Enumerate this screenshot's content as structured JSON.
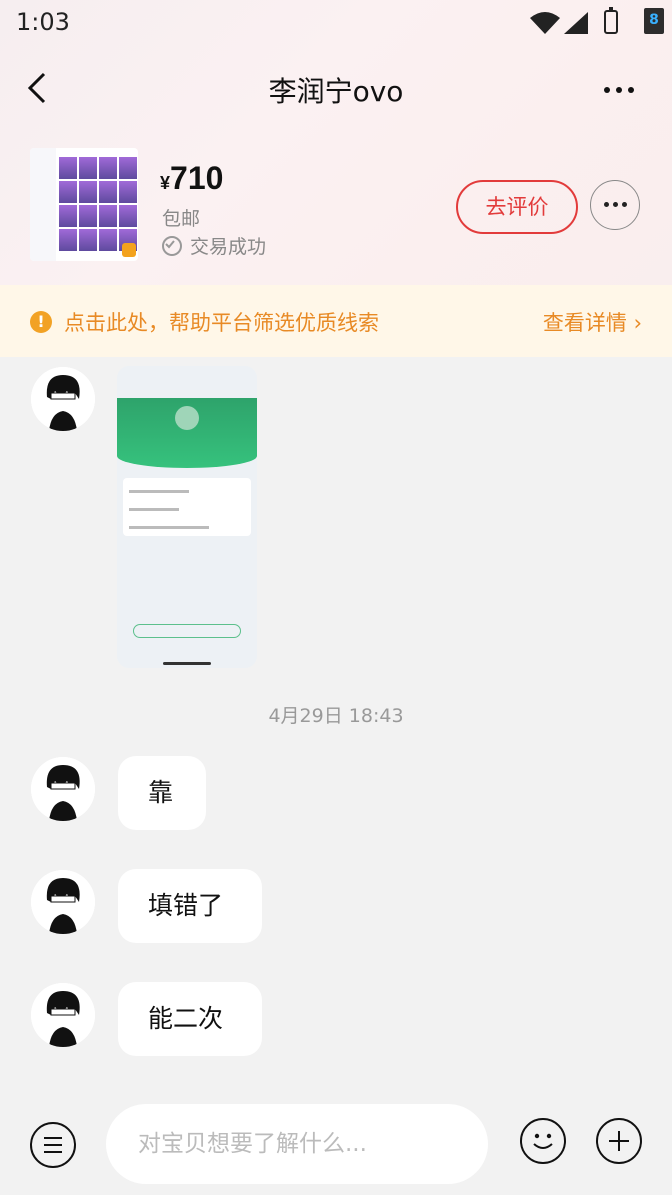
{
  "status_bar": {
    "time": "1:03",
    "notification_badge": "8"
  },
  "header": {
    "title": "李润宁ovo"
  },
  "product": {
    "currency": "¥",
    "price": "710",
    "shipping": "包邮",
    "deal_status": "交易成功",
    "review_button": "去评价"
  },
  "notice": {
    "icon": "!",
    "text": "点击此处，帮助平台筛选优质线索",
    "link": "查看详情 ›"
  },
  "chat": {
    "image_message": "screenshot-image",
    "timestamp": "4月29日 18:43",
    "messages": [
      {
        "text": "靠"
      },
      {
        "text": "填错了"
      },
      {
        "text": "能二次"
      }
    ]
  },
  "input": {
    "placeholder": "对宝贝想要了解什么..."
  },
  "icons": {
    "back": "back-arrow-icon",
    "more": "more-dots-icon",
    "menu": "menu-icon",
    "emoji": "emoji-icon",
    "plus": "plus-icon"
  },
  "colors": {
    "accent_red": "#e23b3b",
    "notice_orange": "#e88a25",
    "notice_bg": "#fff7e8"
  }
}
